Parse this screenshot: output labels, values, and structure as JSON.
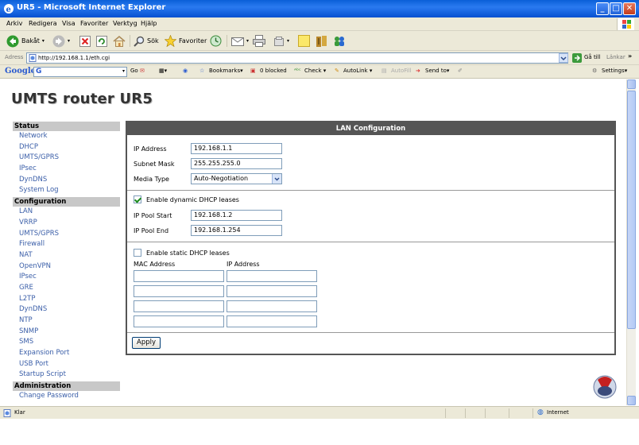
{
  "window": {
    "title": "UR5 - Microsoft Internet Explorer",
    "min": "_",
    "max": "□",
    "close": "✕"
  },
  "menu": [
    "Arkiv",
    "Redigera",
    "Visa",
    "Favoriter",
    "Verktyg",
    "Hjälp"
  ],
  "toolbar": {
    "back": "Bakåt",
    "search": "Sök",
    "favorites": "Favoriter"
  },
  "address": {
    "label": "Adress",
    "url": "http://192.168.1.1/eth.cgi",
    "go": "Gå till",
    "links": "Länkar"
  },
  "google_bar": {
    "logo": "Google",
    "go": "Go",
    "bookmarks": "Bookmarks▾",
    "blocked": "0 blocked",
    "check": "Check ▾",
    "autolink": "AutoLink ▾",
    "autofill": "AutoFill",
    "send_to": "Send to▾",
    "settings": "Settings▾"
  },
  "page": {
    "title": "UMTS router UR5"
  },
  "nav": {
    "status": {
      "label": "Status",
      "items": [
        "Network",
        "DHCP",
        "UMTS/GPRS",
        "IPsec",
        "DynDNS",
        "System Log"
      ]
    },
    "configuration": {
      "label": "Configuration",
      "items": [
        "LAN",
        "VRRP",
        "UMTS/GPRS",
        "Firewall",
        "NAT",
        "OpenVPN",
        "IPsec",
        "GRE",
        "L2TP",
        "DynDNS",
        "NTP",
        "SNMP",
        "SMS",
        "Expansion Port",
        "USB Port",
        "Startup Script"
      ]
    },
    "administration": {
      "label": "Administration",
      "items": [
        "Change Password"
      ]
    }
  },
  "lan": {
    "header": "LAN Configuration",
    "ip_label": "IP Address",
    "ip_value": "192.168.1.1",
    "mask_label": "Subnet Mask",
    "mask_value": "255.255.255.0",
    "media_label": "Media Type",
    "media_value": "Auto-Negotiation",
    "dhcp_dynamic_label": "Enable dynamic DHCP leases",
    "dhcp_dynamic_checked": true,
    "pool_start_label": "IP Pool Start",
    "pool_start_value": "192.168.1.2",
    "pool_end_label": "IP Pool End",
    "pool_end_value": "192.168.1.254",
    "dhcp_static_label": "Enable static DHCP leases",
    "dhcp_static_checked": false,
    "col_mac": "MAC Address",
    "col_ip": "IP Address",
    "static_rows": 4,
    "apply": "Apply"
  },
  "status": {
    "text": "Klar",
    "zone": "Internet"
  }
}
